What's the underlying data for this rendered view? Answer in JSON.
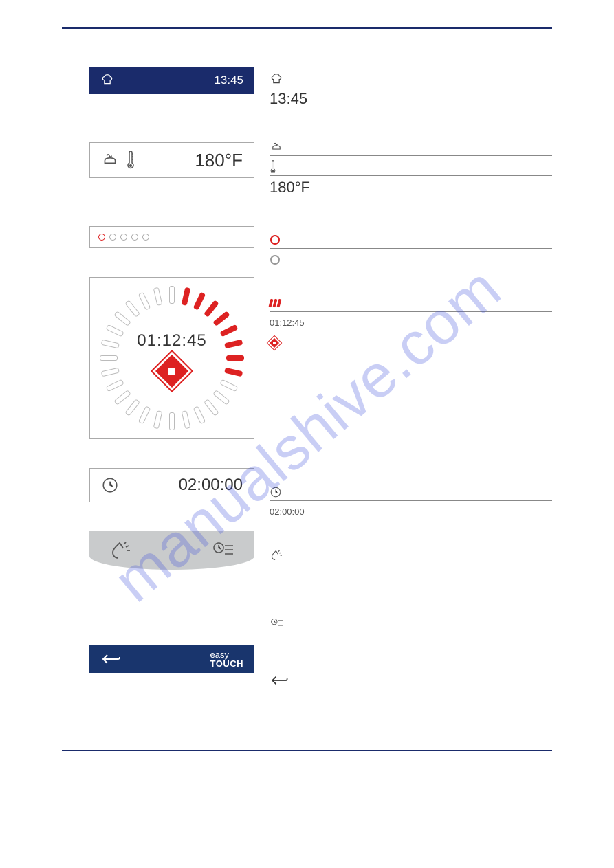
{
  "watermark": "manualshive.com",
  "header_bar": {
    "time": "13:45"
  },
  "temp_row": {
    "temperature": "180°F"
  },
  "desc_time": "13:45",
  "desc_temp": "180°F",
  "dial": {
    "time": "01:12:45",
    "tick_count": 28,
    "active_count": 8
  },
  "desc_dial_time": "01:12:45",
  "clock_row": {
    "value": "02:00:00"
  },
  "desc_clock": "02:00:00",
  "footer": {
    "brand_easy": "easy",
    "brand_touch": "TOUCH"
  }
}
